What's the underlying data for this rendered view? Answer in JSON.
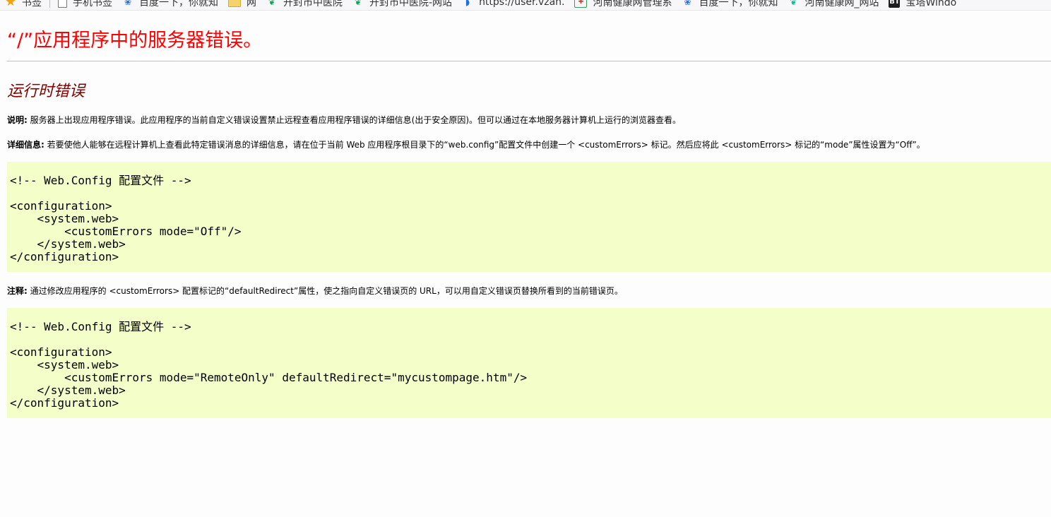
{
  "bookmarks": [
    {
      "icon": "star-icon",
      "label": "书签"
    },
    {
      "icon": "page-icon",
      "label": "手机书签"
    },
    {
      "icon": "baidu-paw-icon",
      "label": "百度一下，你就知"
    },
    {
      "icon": "folder-icon",
      "label": "网"
    },
    {
      "icon": "hospital-leaf-icon",
      "label": "开封市中医院"
    },
    {
      "icon": "hospital-leaf-icon",
      "label": "开封市中医院-网站"
    },
    {
      "icon": "vzan-icon",
      "label": "https://user.vzan."
    },
    {
      "icon": "shield-icon",
      "label": "河南健康网管理系"
    },
    {
      "icon": "baidu-paw-icon",
      "label": "百度一下，你就知"
    },
    {
      "icon": "teal-leaf-icon",
      "label": "河南健康网_网站"
    },
    {
      "icon": "bt-icon",
      "label": "宝塔Windo"
    }
  ],
  "page": {
    "title": "“/”应用程序中的服务器错误。",
    "subtitle": "运行时错误",
    "description_label": "说明:",
    "description_text": " 服务器上出现应用程序错误。此应用程序的当前自定义错误设置禁止远程查看应用程序错误的详细信息(出于安全原因)。但可以通过在本地服务器计算机上运行的浏览器查看。",
    "details_label": "详细信息:",
    "details_text": " 若要使他人能够在远程计算机上查看此特定错误消息的详细信息，请在位于当前 Web 应用程序根目录下的“web.config”配置文件中创建一个 <customErrors> 标记。然后应将此 <customErrors> 标记的“mode”属性设置为“Off”。",
    "code1": "\n<!-- Web.Config 配置文件 -->\n\n<configuration>\n    <system.web>\n        <customErrors mode=\"Off\"/>\n    </system.web>\n</configuration>",
    "notes_label": "注释:",
    "notes_text": " 通过修改应用程序的 <customErrors> 配置标记的“defaultRedirect”属性，使之指向自定义错误页的 URL，可以用自定义错误页替换所看到的当前错误页。",
    "code2": "\n<!-- Web.Config 配置文件 -->\n\n<configuration>\n    <system.web>\n        <customErrors mode=\"RemoteOnly\" defaultRedirect=\"mycustompage.htm\"/>\n    </system.web>\n</configuration>"
  },
  "colors": {
    "title": "#ff0000",
    "subtitle": "#800000",
    "code_background": "#f4fec8"
  }
}
